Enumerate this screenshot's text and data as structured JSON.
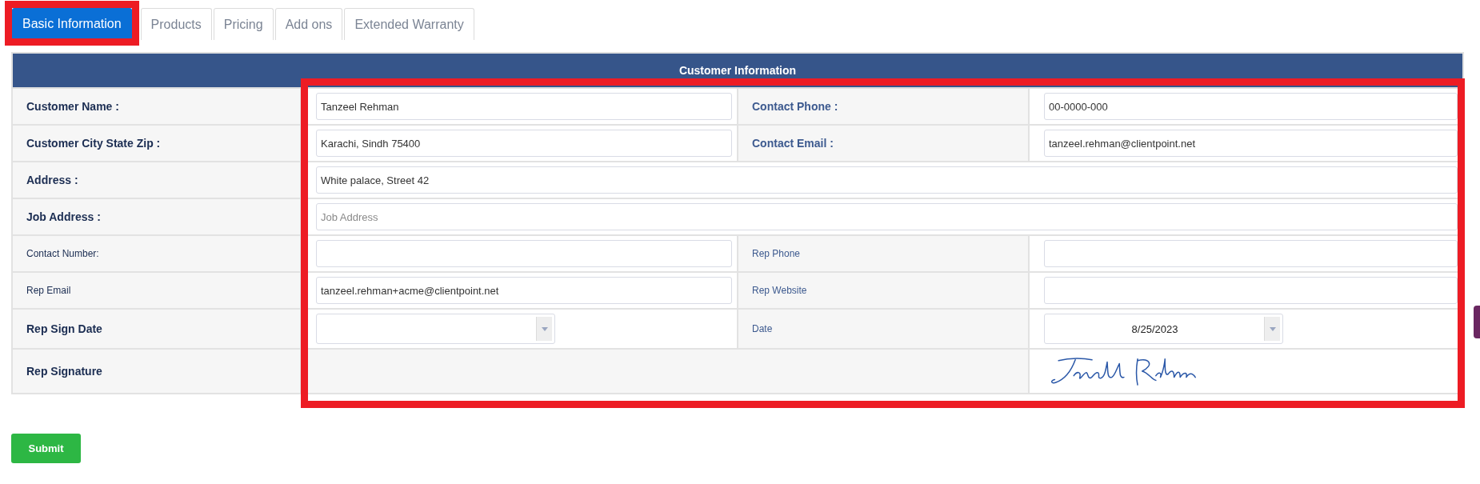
{
  "tabs": [
    {
      "label": "Basic Information",
      "selected": true,
      "highlighted": true
    },
    {
      "label": "Products",
      "selected": false,
      "highlighted": false
    },
    {
      "label": "Pricing",
      "selected": false,
      "highlighted": false
    },
    {
      "label": "Add ons",
      "selected": false,
      "highlighted": false
    },
    {
      "label": "Extended Warranty",
      "selected": false,
      "highlighted": false
    }
  ],
  "form": {
    "title": "Customer Information",
    "fields_highlighted": true,
    "rows": [
      {
        "cells": [
          {
            "kind": "label",
            "text": "Customer Name :",
            "bold": true
          },
          {
            "kind": "input",
            "value": "Tanzeel Rehman"
          },
          {
            "kind": "label",
            "text": "Contact Phone :",
            "bold": true
          },
          {
            "kind": "input",
            "value": "00-0000-000"
          }
        ]
      },
      {
        "cells": [
          {
            "kind": "label",
            "text": "Customer City State Zip :",
            "bold": true
          },
          {
            "kind": "input",
            "value": "Karachi, Sindh 75400"
          },
          {
            "kind": "label",
            "text": "Contact Email :",
            "bold": true
          },
          {
            "kind": "input",
            "value": "tanzeel.rehman@clientpoint.net"
          }
        ]
      },
      {
        "cells": [
          {
            "kind": "label",
            "text": "Address :",
            "bold": true
          },
          {
            "kind": "input",
            "value": "White palace, Street 42",
            "colspan": 3
          }
        ]
      },
      {
        "cells": [
          {
            "kind": "label",
            "text": "Job Address :",
            "bold": true
          },
          {
            "kind": "input",
            "placeholder": "Job Address",
            "colspan": 3
          }
        ]
      },
      {
        "cells": [
          {
            "kind": "label",
            "text": "Contact Number:",
            "bold": false
          },
          {
            "kind": "input"
          },
          {
            "kind": "label",
            "text": "Rep Phone",
            "bold": false
          },
          {
            "kind": "input"
          }
        ]
      },
      {
        "cells": [
          {
            "kind": "label",
            "text": "Rep Email",
            "bold": false
          },
          {
            "kind": "input",
            "value": "tanzeel.rehman+acme@clientpoint.net"
          },
          {
            "kind": "label",
            "text": "Rep Website",
            "bold": false
          },
          {
            "kind": "input"
          }
        ]
      },
      {
        "cells": [
          {
            "kind": "label",
            "text": "Rep Sign Date",
            "bold": true
          },
          {
            "kind": "date"
          },
          {
            "kind": "label",
            "text": "Date",
            "bold": false
          },
          {
            "kind": "date",
            "value": "8/25/2023"
          }
        ]
      },
      {
        "cells": [
          {
            "kind": "label",
            "text": "Rep Signature",
            "bold": true
          },
          {
            "kind": "blank",
            "colspan": 2
          },
          {
            "kind": "signature"
          }
        ]
      }
    ]
  },
  "submit_button": {
    "label": "Submit"
  }
}
